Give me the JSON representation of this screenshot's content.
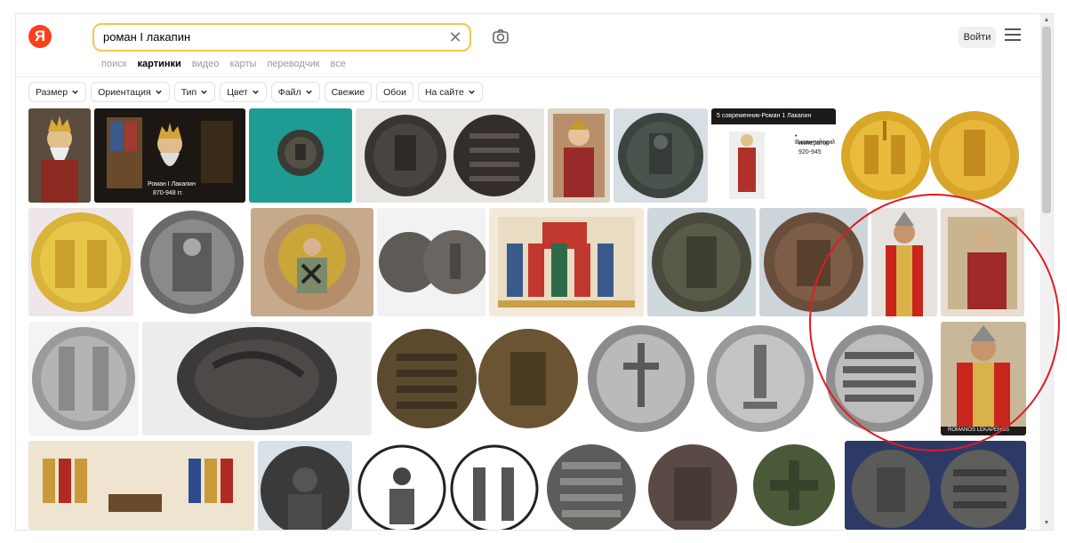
{
  "header": {
    "logo_letter": "Я",
    "search_value": "роман I лакапин",
    "login_label": "Войти"
  },
  "tabs": [
    {
      "label": "поиск",
      "active": false
    },
    {
      "label": "картинки",
      "active": true
    },
    {
      "label": "видео",
      "active": false
    },
    {
      "label": "карты",
      "active": false
    },
    {
      "label": "переводчик",
      "active": false
    },
    {
      "label": "все",
      "active": false
    }
  ],
  "filters": [
    {
      "label": "Размер",
      "dropdown": true
    },
    {
      "label": "Ориентация",
      "dropdown": true
    },
    {
      "label": "Тип",
      "dropdown": true
    },
    {
      "label": "Цвет",
      "dropdown": true
    },
    {
      "label": "Файл",
      "dropdown": true
    },
    {
      "label": "Свежие",
      "dropdown": false
    },
    {
      "label": "Обои",
      "dropdown": false
    },
    {
      "label": "На сайте",
      "dropdown": true
    }
  ],
  "thumb_captions": {
    "roman_caption_1": "Роман I Лакапин",
    "roman_caption_2": "870-948 гг.",
    "contemporary_title": "5 современник-Роман 1 Лакапин",
    "contemporary_text_1": "• Византийский",
    "contemporary_text_2": "император",
    "contemporary_text_3": "920-945",
    "portrait_caption": "ROMANOS LEKAPENOS"
  },
  "colors": {
    "accent_yellow": "#f5c64c",
    "logo_red": "#fc3f1d",
    "annotation_red": "#e01b24"
  }
}
